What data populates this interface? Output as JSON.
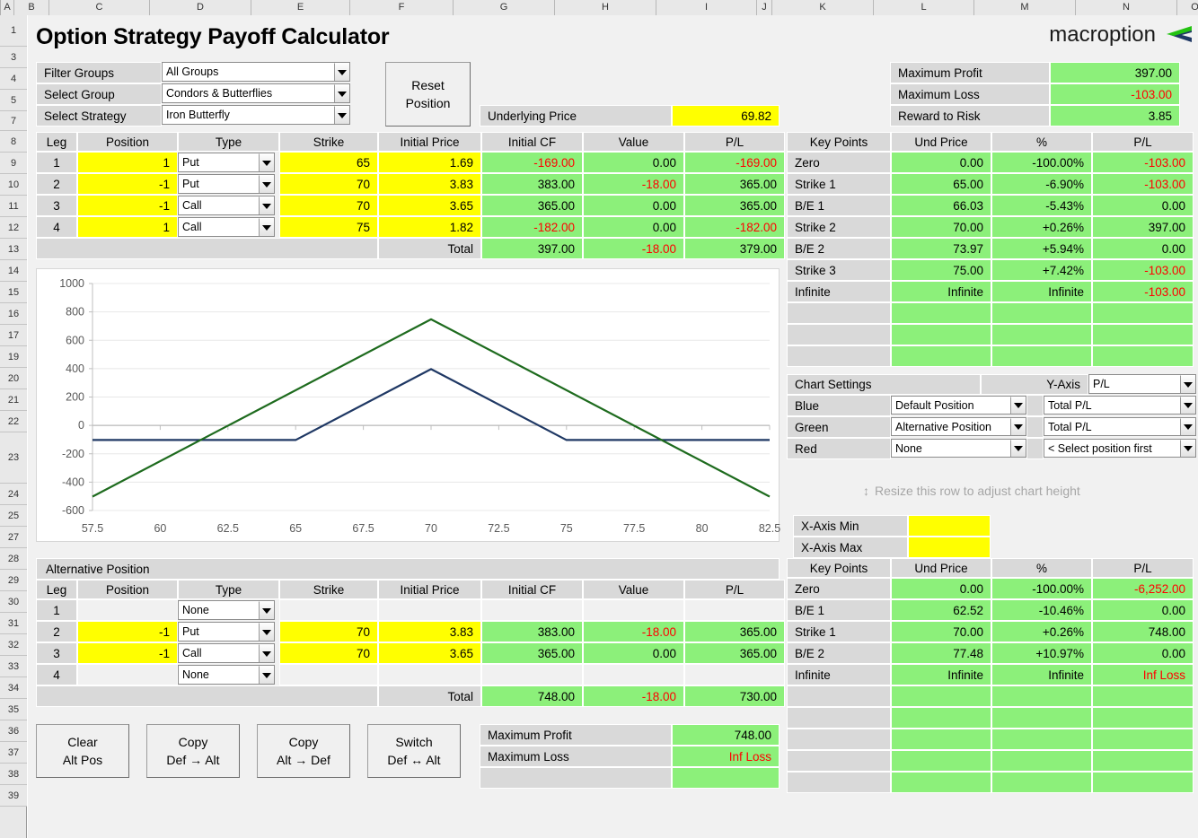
{
  "app": {
    "title": "Option Strategy Payoff Calculator",
    "logo_text": "macroption"
  },
  "grid": {
    "columns": [
      "A",
      "B",
      "C",
      "D",
      "E",
      "F",
      "G",
      "H",
      "I",
      "J",
      "K",
      "L",
      "M",
      "N",
      "O"
    ],
    "rows": [
      "1",
      "3",
      "4",
      "5",
      "7",
      "8",
      "9",
      "10",
      "11",
      "12",
      "13",
      "14",
      "15",
      "16",
      "17",
      "19",
      "20",
      "21",
      "22",
      "23",
      "24",
      "25",
      "27",
      "28",
      "29",
      "30",
      "31",
      "32",
      "33",
      "34",
      "35",
      "36",
      "37",
      "38",
      "39"
    ]
  },
  "selectors": {
    "filter_groups_label": "Filter Groups",
    "filter_groups_value": "All Groups",
    "select_group_label": "Select Group",
    "select_group_value": "Condors & Butterflies",
    "select_strategy_label": "Select Strategy",
    "select_strategy_value": "Iron Butterfly",
    "reset_button_line1": "Reset",
    "reset_button_line2": "Position"
  },
  "underlying": {
    "label": "Underlying Price",
    "value": "69.82"
  },
  "summary_top": {
    "rows": [
      {
        "label": "Maximum Profit",
        "value": "397.00",
        "negative": false
      },
      {
        "label": "Maximum Loss",
        "value": "-103.00",
        "negative": true
      },
      {
        "label": "Reward to Risk",
        "value": "3.85",
        "negative": false
      }
    ]
  },
  "position_table": {
    "headers": [
      "Leg",
      "Position",
      "Type",
      "Strike",
      "Initial Price",
      "Initial CF",
      "Value",
      "P/L"
    ],
    "rows": [
      {
        "leg": "1",
        "position": "1",
        "type": "Put",
        "strike": "65",
        "initial_price": "1.69",
        "initial_cf": "-169.00",
        "cf_neg": true,
        "value": "0.00",
        "value_neg": false,
        "pl": "-169.00",
        "pl_neg": true
      },
      {
        "leg": "2",
        "position": "-1",
        "type": "Put",
        "strike": "70",
        "initial_price": "3.83",
        "initial_cf": "383.00",
        "cf_neg": false,
        "value": "-18.00",
        "value_neg": true,
        "pl": "365.00",
        "pl_neg": false
      },
      {
        "leg": "3",
        "position": "-1",
        "type": "Call",
        "strike": "70",
        "initial_price": "3.65",
        "initial_cf": "365.00",
        "cf_neg": false,
        "value": "0.00",
        "value_neg": false,
        "pl": "365.00",
        "pl_neg": false
      },
      {
        "leg": "4",
        "position": "1",
        "type": "Call",
        "strike": "75",
        "initial_price": "1.82",
        "initial_cf": "-182.00",
        "cf_neg": true,
        "value": "0.00",
        "value_neg": false,
        "pl": "-182.00",
        "pl_neg": true
      }
    ],
    "total_label": "Total",
    "total_initial_cf": "397.00",
    "total_value": "-18.00",
    "total_pl": "379.00"
  },
  "key_points_top": {
    "headers": [
      "Key Points",
      "Und Price",
      "%",
      "P/L"
    ],
    "rows": [
      {
        "name": "Zero",
        "und_price": "0.00",
        "pct": "-100.00%",
        "pl": "-103.00",
        "pl_neg": true
      },
      {
        "name": "Strike 1",
        "und_price": "65.00",
        "pct": "-6.90%",
        "pl": "-103.00",
        "pl_neg": true
      },
      {
        "name": "B/E 1",
        "und_price": "66.03",
        "pct": "-5.43%",
        "pl": "0.00",
        "pl_neg": false
      },
      {
        "name": "Strike 2",
        "und_price": "70.00",
        "pct": "+0.26%",
        "pl": "397.00",
        "pl_neg": false
      },
      {
        "name": "B/E 2",
        "und_price": "73.97",
        "pct": "+5.94%",
        "pl": "0.00",
        "pl_neg": false
      },
      {
        "name": "Strike 3",
        "und_price": "75.00",
        "pct": "+7.42%",
        "pl": "-103.00",
        "pl_neg": true
      },
      {
        "name": "Infinite",
        "und_price": "Infinite",
        "pct": "Infinite",
        "pl": "-103.00",
        "pl_neg": true
      },
      {
        "name": "",
        "und_price": "",
        "pct": "",
        "pl": "",
        "pl_neg": false
      },
      {
        "name": "",
        "und_price": "",
        "pct": "",
        "pl": "",
        "pl_neg": false
      },
      {
        "name": "",
        "und_price": "",
        "pct": "",
        "pl": "",
        "pl_neg": false
      }
    ]
  },
  "chart_settings": {
    "title": "Chart Settings",
    "yaxis_label": "Y-Axis",
    "yaxis_value": "P/L",
    "rows": [
      {
        "color_label": "Blue",
        "position": "Default Position",
        "series": "Total P/L"
      },
      {
        "color_label": "Green",
        "position": "Alternative Position",
        "series": "Total P/L"
      },
      {
        "color_label": "Red",
        "position": "None",
        "series": "< Select position first"
      }
    ],
    "resize_hint": "Resize this row to adjust chart height",
    "x_min_label": "X-Axis Min",
    "x_min_value": "",
    "x_max_label": "X-Axis Max",
    "x_max_value": ""
  },
  "alternative_position": {
    "title": "Alternative Position",
    "headers": [
      "Leg",
      "Position",
      "Type",
      "Strike",
      "Initial Price",
      "Initial CF",
      "Value",
      "P/L"
    ],
    "rows": [
      {
        "leg": "1",
        "position": "",
        "type": "None",
        "strike": "",
        "initial_price": "",
        "initial_cf": "",
        "cf_neg": false,
        "value": "",
        "value_neg": false,
        "pl": "",
        "pl_neg": false,
        "empty": true
      },
      {
        "leg": "2",
        "position": "-1",
        "type": "Put",
        "strike": "70",
        "initial_price": "3.83",
        "initial_cf": "383.00",
        "cf_neg": false,
        "value": "-18.00",
        "value_neg": true,
        "pl": "365.00",
        "pl_neg": false,
        "empty": false
      },
      {
        "leg": "3",
        "position": "-1",
        "type": "Call",
        "strike": "70",
        "initial_price": "3.65",
        "initial_cf": "365.00",
        "cf_neg": false,
        "value": "0.00",
        "value_neg": false,
        "pl": "365.00",
        "pl_neg": false,
        "empty": false
      },
      {
        "leg": "4",
        "position": "",
        "type": "None",
        "strike": "",
        "initial_price": "",
        "initial_cf": "",
        "cf_neg": false,
        "value": "",
        "value_neg": false,
        "pl": "",
        "pl_neg": false,
        "empty": true
      }
    ],
    "total_label": "Total",
    "total_initial_cf": "748.00",
    "total_value": "-18.00",
    "total_pl": "730.00"
  },
  "key_points_bottom": {
    "headers": [
      "Key Points",
      "Und Price",
      "%",
      "P/L"
    ],
    "rows": [
      {
        "name": "Zero",
        "und_price": "0.00",
        "pct": "-100.00%",
        "pl": "-6,252.00",
        "pl_neg": true
      },
      {
        "name": "B/E 1",
        "und_price": "62.52",
        "pct": "-10.46%",
        "pl": "0.00",
        "pl_neg": false
      },
      {
        "name": "Strike 1",
        "und_price": "70.00",
        "pct": "+0.26%",
        "pl": "748.00",
        "pl_neg": false
      },
      {
        "name": "B/E 2",
        "und_price": "77.48",
        "pct": "+10.97%",
        "pl": "0.00",
        "pl_neg": false
      },
      {
        "name": "Infinite",
        "und_price": "Infinite",
        "pct": "Infinite",
        "pl": "Inf Loss",
        "pl_neg": true
      },
      {
        "name": "",
        "und_price": "",
        "pct": "",
        "pl": "",
        "pl_neg": false
      },
      {
        "name": "",
        "und_price": "",
        "pct": "",
        "pl": "",
        "pl_neg": false
      },
      {
        "name": "",
        "und_price": "",
        "pct": "",
        "pl": "",
        "pl_neg": false
      },
      {
        "name": "",
        "und_price": "",
        "pct": "",
        "pl": "",
        "pl_neg": false
      },
      {
        "name": "",
        "und_price": "",
        "pct": "",
        "pl": "",
        "pl_neg": false
      }
    ]
  },
  "action_buttons": [
    {
      "line1": "Clear",
      "line2": "Alt Pos"
    },
    {
      "line1": "Copy",
      "line2": "Def → Alt"
    },
    {
      "line1": "Copy",
      "line2": "Alt → Def"
    },
    {
      "line1": "Switch",
      "line2": "Def ↔ Alt"
    }
  ],
  "summary_bottom": {
    "rows": [
      {
        "label": "Maximum Profit",
        "value": "748.00",
        "negative": false
      },
      {
        "label": "Maximum Loss",
        "value": "Inf Loss",
        "negative": true
      },
      {
        "label": "",
        "value": "",
        "negative": false
      }
    ]
  },
  "colors": {
    "blue_series": "#1F3864",
    "green_series": "#1E6B1E",
    "input_yellow": "#FFFF00",
    "output_green": "#8CF07A",
    "label_grey": "#D9D9D9",
    "negative_red": "#FF0000"
  },
  "chart_data": {
    "type": "line",
    "title": "",
    "xlabel": "",
    "ylabel": "",
    "xlim": [
      57.5,
      82.5
    ],
    "ylim": [
      -600,
      1000
    ],
    "xticks": [
      "57.5",
      "60",
      "62.5",
      "65",
      "67.5",
      "70",
      "72.5",
      "75",
      "77.5",
      "80",
      "82.5"
    ],
    "yticks": [
      "-600",
      "-400",
      "-200",
      "0",
      "200",
      "400",
      "600",
      "800",
      "1000"
    ],
    "grid": true,
    "legend": "none",
    "series": [
      {
        "name": "Default Position (Blue) Total P/L",
        "color": "#1F3864",
        "x": [
          57.5,
          65,
          70,
          75,
          82.5
        ],
        "y": [
          -103,
          -103,
          397,
          -103,
          -103
        ]
      },
      {
        "name": "Alternative Position (Green) Total P/L",
        "color": "#1E6B1E",
        "x": [
          57.5,
          70,
          82.5
        ],
        "y": [
          -502,
          748,
          -502
        ]
      }
    ]
  }
}
